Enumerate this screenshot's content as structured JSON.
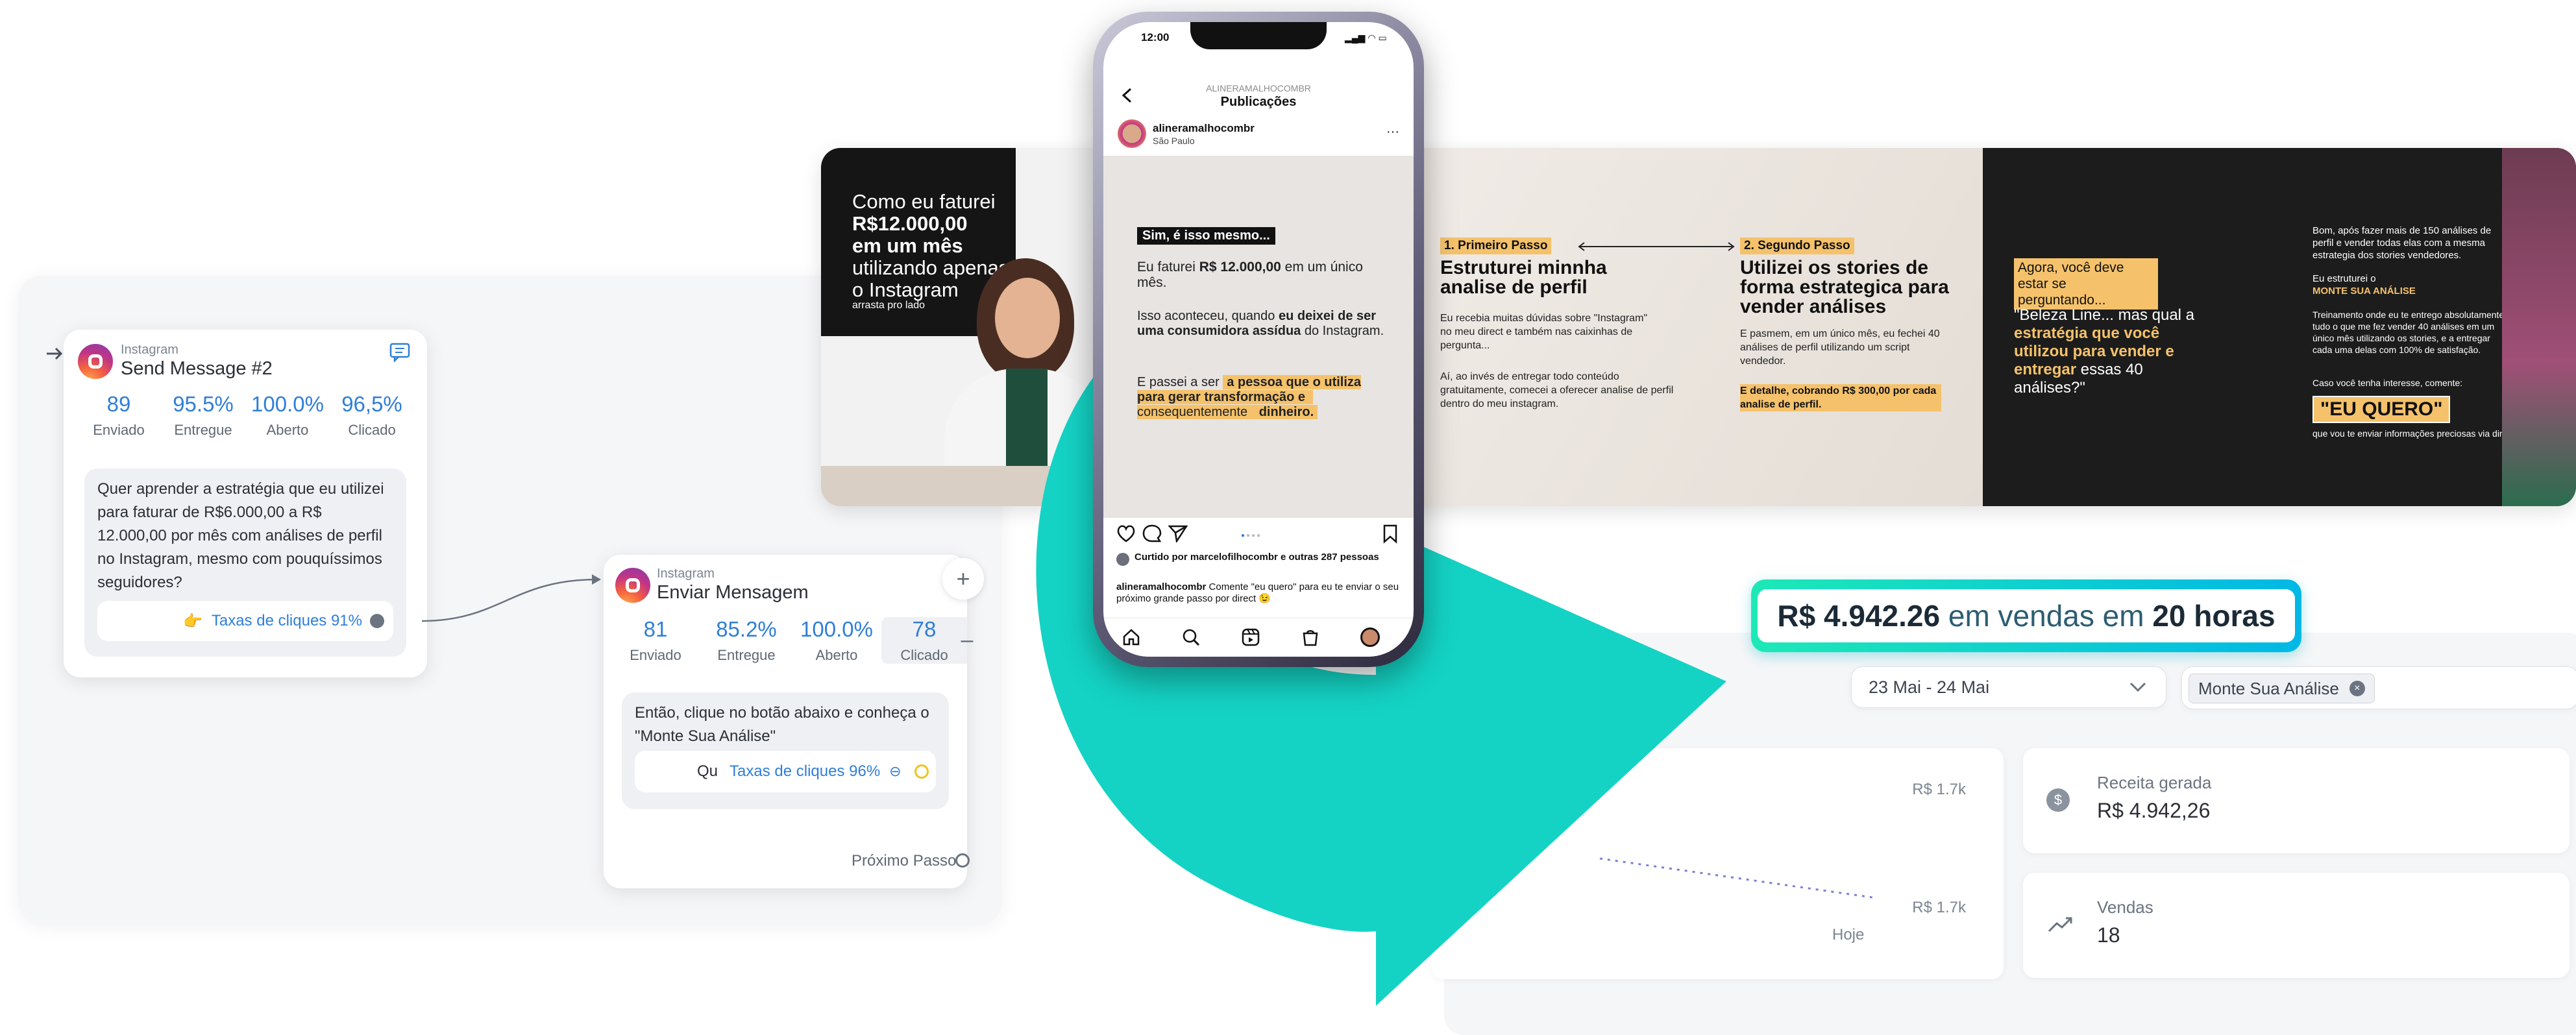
{
  "flow": {
    "node1": {
      "platform": "Instagram",
      "title": "Send Message #2",
      "stats": [
        {
          "value": "89",
          "label": "Enviado"
        },
        {
          "value": "95.5%",
          "label": "Entregue"
        },
        {
          "value": "100.0%",
          "label": "Aberto"
        },
        {
          "value": "96,5%",
          "label": "Clicado"
        }
      ],
      "message": "Quer aprender a estratégia que eu utilizei para faturar de R$6.000,00 a R$ 12.000,00 por mês com análises de perfil no Instagram, mesmo com pouquíssimos seguidores?",
      "button_emoji": "👉",
      "button_label": "Taxas de cliques 91%"
    },
    "node2": {
      "platform": "Instagram",
      "title": "Enviar Mensagem",
      "stats": [
        {
          "value": "81",
          "label": "Enviado"
        },
        {
          "value": "85.2%",
          "label": "Entregue"
        },
        {
          "value": "100.0%",
          "label": "Aberto"
        },
        {
          "value": "78",
          "label": "Clicado"
        }
      ],
      "message": "Então, clique no botão abaixo e conheça o \"Monte Sua Análise\"",
      "button_prefix": "Qu",
      "button_label": "Taxas de cliques 96%",
      "next_step": "Próximo Passo",
      "add_symbol": "+",
      "minus_symbol": "–"
    }
  },
  "phone": {
    "time": "12:00",
    "header_account": "ALINERAMALHOCOMBR",
    "header_title": "Publicações",
    "username": "alineramalhocombr",
    "location": "São Paulo",
    "post": {
      "tag": "Sim, é isso mesmo...",
      "p1_a": "Eu faturei ",
      "p1_b": "R$ 12.000,00",
      "p1_c": " em um único mês.",
      "p2_a": "Isso aconteceu, quando ",
      "p2_b": "eu deixei de ser uma consumidora assídua",
      "p2_c": " do Instagram.",
      "p3_a": "E passei a ser ",
      "p3_b": "a pessoa que o utiliza para gerar transformação e",
      "p3_c": " consequentemente ",
      "p3_d": "dinheiro."
    },
    "liked_by": "Curtido por marcelofilhocombr e outras 287 pessoas",
    "caption_user": "alineramalhocombr",
    "caption_text": " Comente \"eu quero\" para eu te enviar o seu próximo grande passo por direct 😉"
  },
  "carousel": {
    "s1_line1": "Como eu faturei",
    "s1_line2": "R$12.000,00",
    "s1_line3": "em um mês",
    "s1_line4": "utilizando apenas",
    "s1_line5": "o Instagram",
    "s1_footer": "arrasta pro lado",
    "step1_tag": "1. Primeiro Passo",
    "step1_title": "Estruturei minnha analise de perfil",
    "step1_p1": "Eu recebia muitas dúvidas sobre \"Instagram\" no meu direct e também nas caixinhas de pergunta...",
    "step1_p2": "Aí, ao invés de entregar todo conteúdo gratuitamente, comecei a oferecer analise de perfil dentro do meu instagram.",
    "step2_tag": "2. Segundo Passo",
    "step2_title": "Utilizei os stories de forma estrategica para vender análises",
    "step2_p1": "E pasmem, em um único mês, eu fechei 40 análises de perfil utilizando um script vendedor.",
    "step2_p2": "E detalhe, cobrando R$ 300,00 por cada analise de perfil.",
    "s3_q": "Agora, você deve estar se perguntando...",
    "s3_q2_a": "\"Beleza Line... mas qual a ",
    "s3_q2_b": "estratégia que você utilizou para vender e entregar",
    "s3_q2_c": " essas 40 análises?\"",
    "s4_p1": "Bom, após fazer mais de 150 análises de perfil e vender todas elas com a mesma estrategia dos stories vendedores.",
    "s4_p2_a": "Eu estruturei o",
    "s4_p2_b": "MONTE SUA ANÁLISE",
    "s4_p3": "Treinamento onde eu te entrego absolutamente tudo o que me fez vender 40 análises em um único mês utilizando os stories, e a entregar cada uma delas com 100% de satisfação.",
    "s4_p4": "Caso você tenha interesse, comente:",
    "s4_cta": "\"EU QUERO\"",
    "s4_p5": "que vou te  enviar informações preciosas via direct."
  },
  "dashboard": {
    "banner_amount": "R$ 4.942.26",
    "banner_mid": " em vendas em ",
    "banner_time": "20 horas",
    "date_range": "23 Mai - 24 Mai",
    "product_filter": "Monte Sua Análise",
    "chart_top_label": "R$ 1.7k",
    "chart_bottom_label": "R$ 1.7k",
    "chart_x_label": "Hoje",
    "revenue_label": "Receita gerada",
    "revenue_value": "R$ 4.942,26",
    "sales_label": "Vendas",
    "sales_value": "18"
  },
  "colors": {
    "accent_blue": "#2f7ed8",
    "teal_arrow": "#14d3c4",
    "gold": "#f5c26b"
  }
}
